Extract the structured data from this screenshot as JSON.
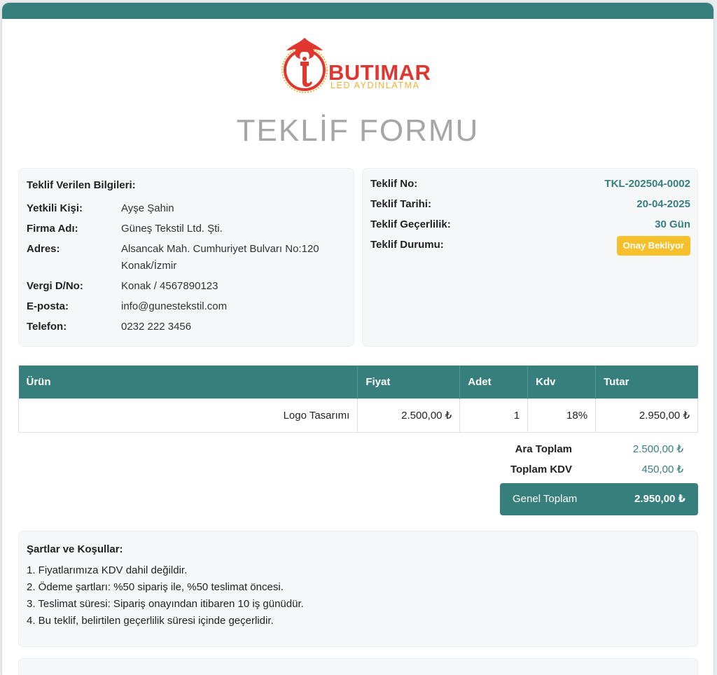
{
  "brand": {
    "name": "BUTIMAR",
    "tagline": "LED AYDINLATMA",
    "colors": {
      "primary": "#367f7c",
      "logo_red": "#e03630",
      "logo_gold": "#f2b232",
      "badge": "#f5c02b"
    }
  },
  "document": {
    "title": "TEKLİF FORMU"
  },
  "customer": {
    "heading": "Teklif Verilen Bilgileri:",
    "rows": [
      {
        "label": "Yetkili Kişi:",
        "value": "Ayşe Şahin"
      },
      {
        "label": "Firma Adı:",
        "value": "Güneş Tekstil Ltd. Şti."
      },
      {
        "label": "Adres:",
        "value": "Alsancak Mah. Cumhuriyet Bulvarı No:120 Konak/İzmir"
      },
      {
        "label": "Vergi D/No:",
        "value": "Konak / 4567890123"
      },
      {
        "label": "E-posta:",
        "value": "info@gunestekstil.com"
      },
      {
        "label": "Telefon:",
        "value": "0232 222 3456"
      }
    ]
  },
  "offer": {
    "rows": [
      {
        "label": "Teklif No:",
        "value": "TKL-202504-0002"
      },
      {
        "label": "Teklif Tarihi:",
        "value": "20-04-2025"
      },
      {
        "label": "Teklif Geçerlilik:",
        "value": "30 Gün"
      },
      {
        "label": "Teklif Durumu:",
        "value": "Onay Bekliyor"
      }
    ]
  },
  "items_table": {
    "columns": [
      "Ürün",
      "Fiyat",
      "Adet",
      "Kdv",
      "Tutar"
    ],
    "rows": [
      [
        "Logo Tasarımı",
        "2.500,00 ₺",
        "1",
        "18%",
        "2.950,00 ₺"
      ]
    ]
  },
  "totals": {
    "subtotal_label": "Ara Toplam",
    "subtotal_value": "2.500,00 ₺",
    "vat_label": "Toplam KDV",
    "vat_value": "450,00 ₺",
    "grand_label": "Genel Toplam",
    "grand_value": "2.950,00 ₺"
  },
  "terms": {
    "heading": "Şartlar ve Koşullar:",
    "items": [
      "1. Fiyatlarımıza KDV dahil değildir.",
      "2. Ödeme şartları: %50 sipariş ile, %50 teslimat öncesi.",
      "3. Teslimat süresi: Sipariş onayından itibaren 10 iş günüdür.",
      "4. Bu teklif, belirtilen geçerlilik süresi içinde geçerlidir."
    ]
  }
}
